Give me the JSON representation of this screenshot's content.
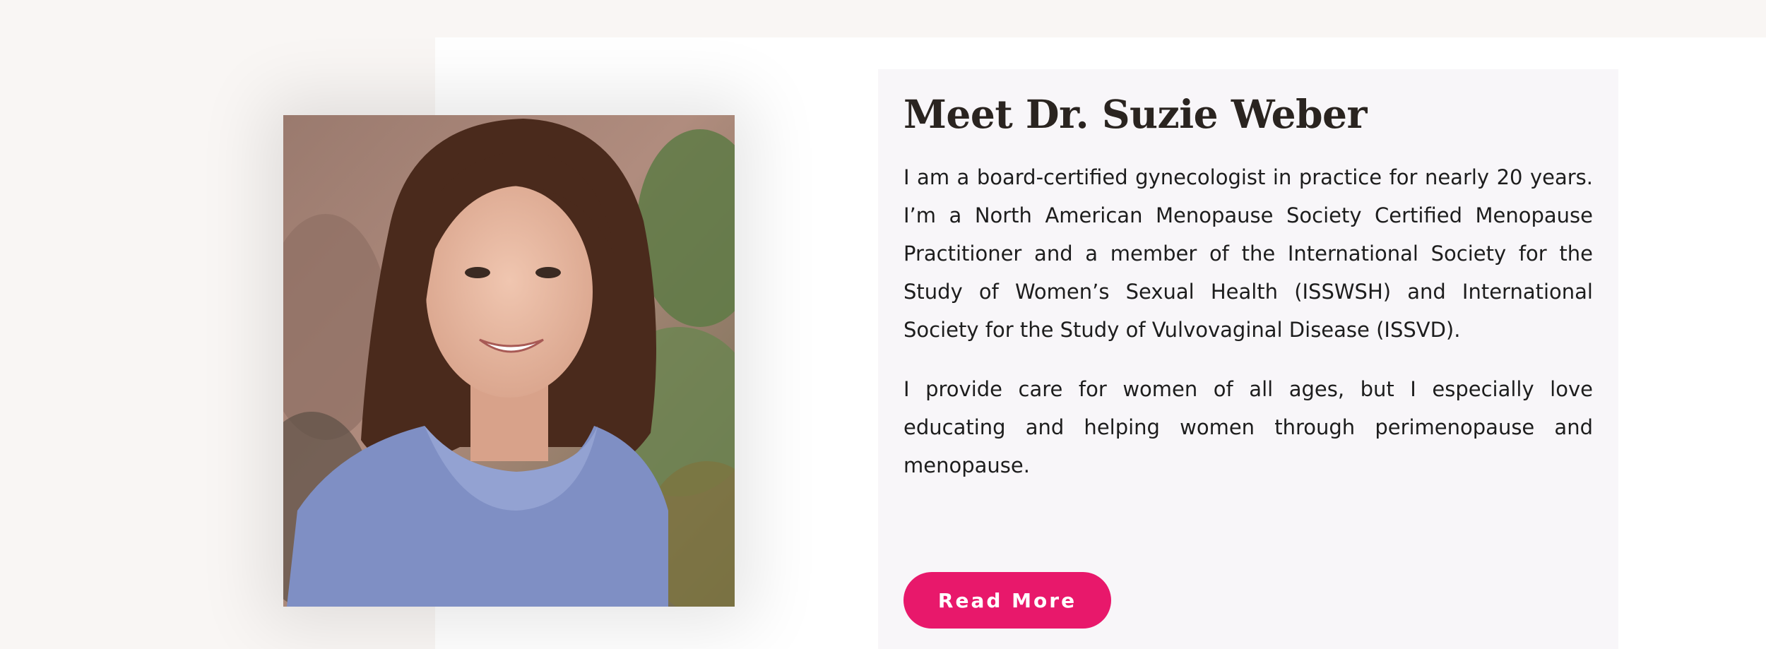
{
  "section": {
    "photo_alt": "Dr. Suzie Weber portrait",
    "heading": "Meet Dr. Suzie Weber",
    "paragraphs": [
      "I am a board-certified gynecologist in practice for nearly 20 years. I’m a North American Menopause Society Certified Menopause Practitioner and a member of the International Society for the Study of Women’s Sexual Health (ISSWSH) and International Society for the Study of Vulvovaginal Disease (ISSVD).",
      "I provide care for women of all ages, but I especially love educating and helping women through perimenopause and menopause."
    ],
    "button_label": "Read More"
  },
  "colors": {
    "page_background": "#f9f6f4",
    "card_background": "#f8f6f9",
    "heading_text": "#2a2420",
    "button_background": "#e8186b",
    "button_text": "#ffffff"
  }
}
